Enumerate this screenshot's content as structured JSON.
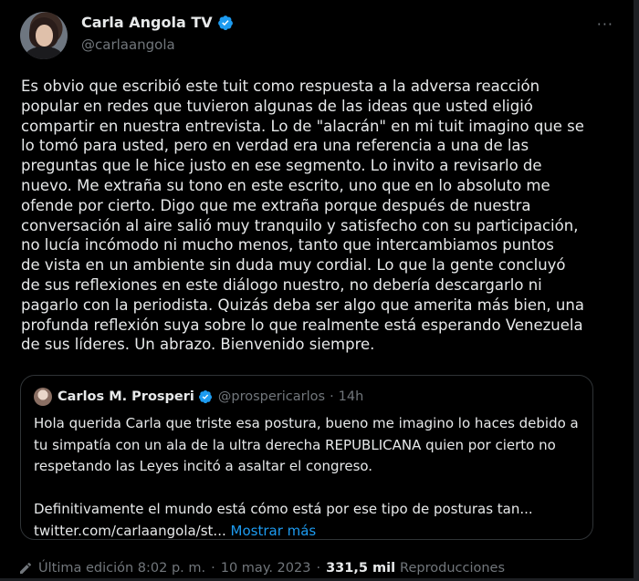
{
  "author": {
    "display_name": "Carla Angola TV",
    "handle": "@carlaangola"
  },
  "menu_icon": "more-horizontal-icon",
  "tweet": {
    "text": "Es obvio que escribió este tuit como respuesta a la adversa reacción\npopular en redes que tuvieron algunas de las ideas que usted eligió\ncompartir en nuestra entrevista. Lo de \"alacrán\" en mi tuit imagino que se\nlo tomó para usted, pero en verdad era una referencia a una de las\npreguntas que le hice justo en ese segmento. Lo invito a revisarlo de\nnuevo. Me extraña su tono en este escrito, uno que en lo absoluto me\nofende por cierto. Digo que me extraña porque después de nuestra\nconversación al aire salió muy tranquilo y satisfecho con su participación,\nno lucía incómodo ni mucho menos, tanto que intercambiamos puntos\nde vista en un ambiente sin duda muy cordial. Lo que la gente concluyó\nde sus reflexiones en este diálogo nuestro, no debería descargarlo ni\npagarlo con la periodista. Quizás deba ser algo que amerita más bien, una\nprofunda reflexión suya sobre lo que realmente está esperando Venezuela\nde sus líderes. Un abrazo. Bienvenido siempre."
  },
  "quoted": {
    "display_name": "Carlos M. Prosperi",
    "handle": "@prospericarlos",
    "separator": "·",
    "time": "14h",
    "text": "Hola querida Carla que triste esa postura, bueno me imagino lo haces debido a\ntu simpatía con un ala de la ultra derecha REPUBLICANA quien por cierto no\nrespetando las Leyes incitó a asaltar el congreso.\n\nDefinitivamente el mundo está cómo está por ese tipo de posturas tan...\ntwitter.com/carlaangola/st... ",
    "show_more": "Mostrar más"
  },
  "footer": {
    "edit_text": "Última edición 8:02 p. m.",
    "sep1": "·",
    "date": "10 may. 2023",
    "sep2": "·",
    "views_count": "331,5 mil",
    "views_label": "Reproducciones"
  },
  "colors": {
    "background": "#000000",
    "text": "#e7e9ea",
    "muted": "#71767b",
    "link": "#1d9bf0",
    "verified": "#1d9bf0",
    "border": "#2f3336"
  }
}
